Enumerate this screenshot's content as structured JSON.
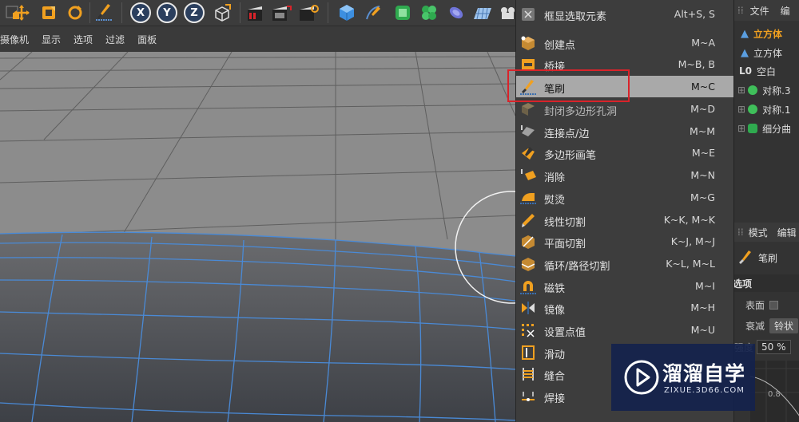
{
  "toolbar": {
    "axis_x": "X",
    "axis_y": "Y",
    "axis_z": "Z"
  },
  "viewport_menu": {
    "items": [
      "摄像机",
      "显示",
      "选项",
      "过滤",
      "面板"
    ]
  },
  "popup_menu": {
    "items": [
      {
        "label": "框显选取元素",
        "shortcut": "Alt+S, S",
        "icon": "frame-select-icon"
      },
      {
        "label": "创建点",
        "shortcut": "M~A",
        "icon": "create-point-icon"
      },
      {
        "label": "桥接",
        "shortcut": "M~B, B",
        "icon": "bridge-icon"
      },
      {
        "label": "笔刷",
        "shortcut": "M~C",
        "icon": "brush-icon"
      },
      {
        "label": "封闭多边形孔洞",
        "shortcut": "M~D",
        "icon": "close-hole-icon"
      },
      {
        "label": "连接点/边",
        "shortcut": "M~M",
        "icon": "connect-points-icon"
      },
      {
        "label": "多边形画笔",
        "shortcut": "M~E",
        "icon": "polygon-pen-icon"
      },
      {
        "label": "消除",
        "shortcut": "M~N",
        "icon": "dissolve-icon"
      },
      {
        "label": "熨烫",
        "shortcut": "M~G",
        "icon": "iron-icon"
      },
      {
        "label": "线性切割",
        "shortcut": "K~K, M~K",
        "icon": "line-cut-icon"
      },
      {
        "label": "平面切割",
        "shortcut": "K~J, M~J",
        "icon": "plane-cut-icon"
      },
      {
        "label": "循环/路径切割",
        "shortcut": "K~L, M~L",
        "icon": "loop-cut-icon"
      },
      {
        "label": "磁铁",
        "shortcut": "M~I",
        "icon": "magnet-icon"
      },
      {
        "label": "镜像",
        "shortcut": "M~H",
        "icon": "mirror-icon"
      },
      {
        "label": "设置点值",
        "shortcut": "M~U",
        "icon": "set-point-value-icon"
      },
      {
        "label": "滑动",
        "shortcut": "",
        "icon": "slide-icon"
      },
      {
        "label": "缝合",
        "shortcut": "",
        "icon": "stitch-icon"
      },
      {
        "label": "焊接",
        "shortcut": "",
        "icon": "weld-icon"
      }
    ],
    "highlighted_index": 3
  },
  "right_panel": {
    "tab_file": "文件",
    "tab_edit": "编",
    "objects": [
      "立方体",
      "立方体",
      "空白",
      "对称.3",
      "对称.1",
      "细分曲"
    ],
    "attr_tab_mode": "模式",
    "attr_tab_edit": "编辑",
    "tool_name": "笔刷",
    "section": "选项",
    "field_surface": "表面",
    "field_falloff": "衰减",
    "falloff_value": "铃状",
    "field_strength": "强度",
    "strength_value": "50 %",
    "graph_tick": "0.8"
  },
  "watermark": {
    "title": "溜溜自学",
    "url": "ZIXUE.3D66.COM"
  },
  "colors": {
    "highlight_border": "#d9232a",
    "menu_highlight": "#a9a9a9",
    "mesh_line": "#4a8ad6",
    "accent_orange": "#f0a020"
  }
}
